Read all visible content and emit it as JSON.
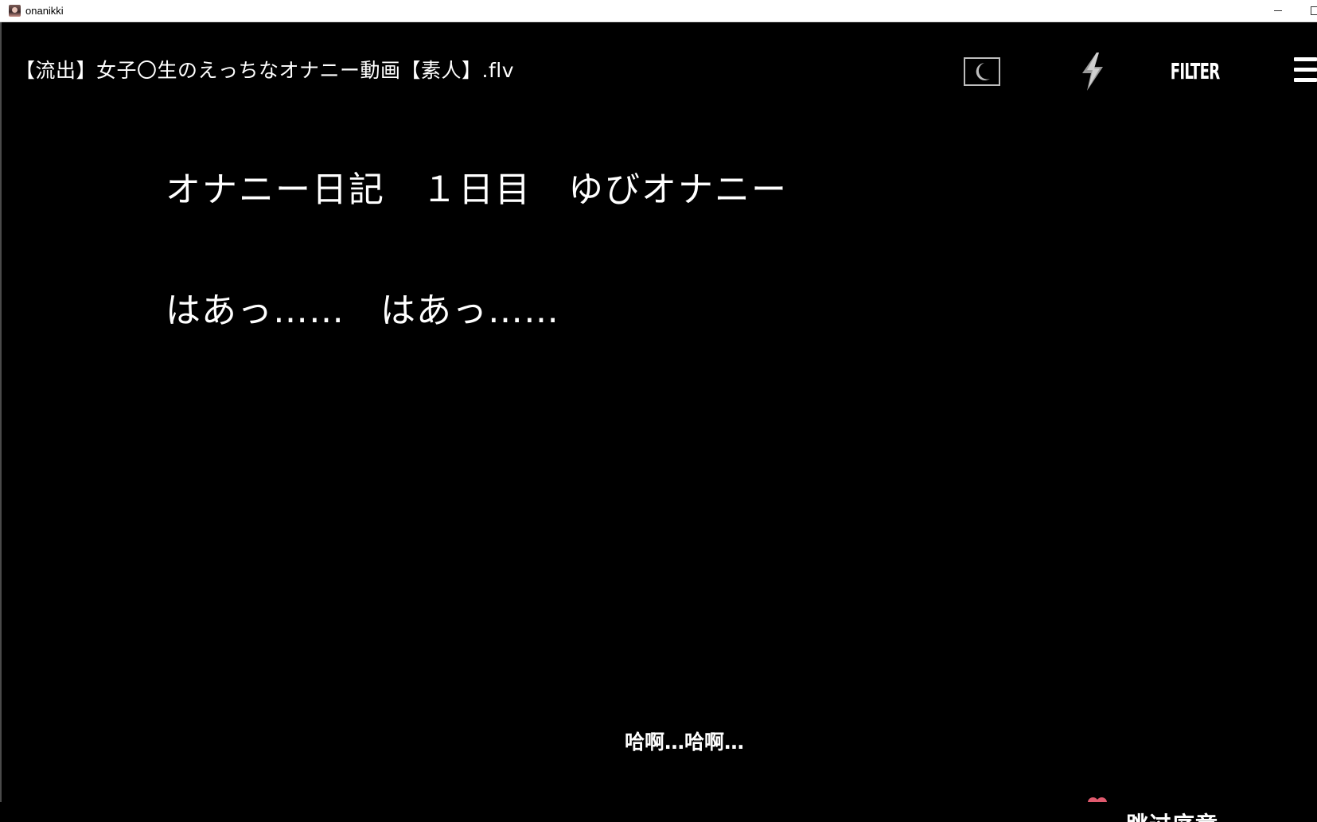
{
  "window": {
    "app_title": "onanikki",
    "app_icon": "app-portrait-icon"
  },
  "header": {
    "video_title": "【流出】女子〇生のえっちなオナニー動画【素人】.flv",
    "moon_icon": "moon-icon",
    "bolt_icon": "lightning-bolt-icon",
    "filter_label": "FILTER",
    "menu_icon": "hamburger-menu-icon"
  },
  "main": {
    "chapter_heading": "オナニー日記　１日目　ゆびオナニー",
    "dialogue": "はあっ……　はあっ……"
  },
  "subtitle": {
    "text": "哈啊…哈啊…"
  },
  "skip": {
    "label": "跳过序章",
    "icon": "heart-icon"
  },
  "colors": {
    "background": "#000000",
    "text": "#ffffff",
    "icon_gray": "#bdbdbd",
    "heart": "#e05a6e"
  }
}
